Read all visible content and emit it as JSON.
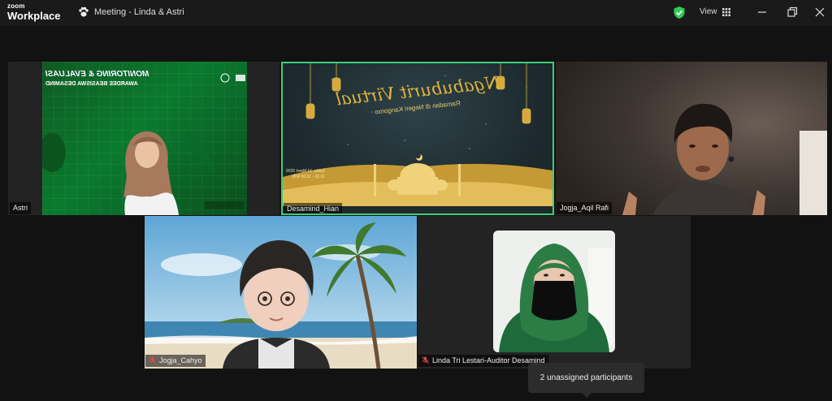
{
  "app": {
    "brand_line1": "zoom",
    "brand_line2": "Workplace",
    "meeting_title": "Meeting - Linda & Astri",
    "view_label": "View"
  },
  "icons": {
    "meeting": "paw-icon",
    "security": "shield-check-icon",
    "view": "grid-icon",
    "minimize": "minimize-icon",
    "restore": "restore-icon",
    "close": "close-icon",
    "muted": "mic-off-icon"
  },
  "colors": {
    "active_speaker_border": "#3ad07a",
    "shield": "#2ecc55",
    "mic_off": "#e04848",
    "banner_gold": "#e2b43d"
  },
  "participants": [
    {
      "name": "Astri",
      "muted": false
    },
    {
      "name": "Desamind_Hian",
      "muted": false,
      "active": true
    },
    {
      "name": "Jogja_Aqil Rafi",
      "muted": false
    },
    {
      "name": "Jogja_Cahyo",
      "muted": true
    },
    {
      "name": "Linda Tri Lestari-Auditor Desamind",
      "muted": true
    }
  ],
  "shared_content": {
    "astri_slide_title": "MONITORING & EVALUASI",
    "astri_slide_subtitle": "AWARDEE BEASISWA DESAMIND",
    "banner_title": "Ngabuburit Virtual",
    "banner_subtitle": "Ramadan di Negeri Kangoroo",
    "banner_date": "Sabtu, 14 Maret 2026",
    "banner_time": "16.30 - 18.00 WIB"
  },
  "tooltip": "2 unassigned participants"
}
